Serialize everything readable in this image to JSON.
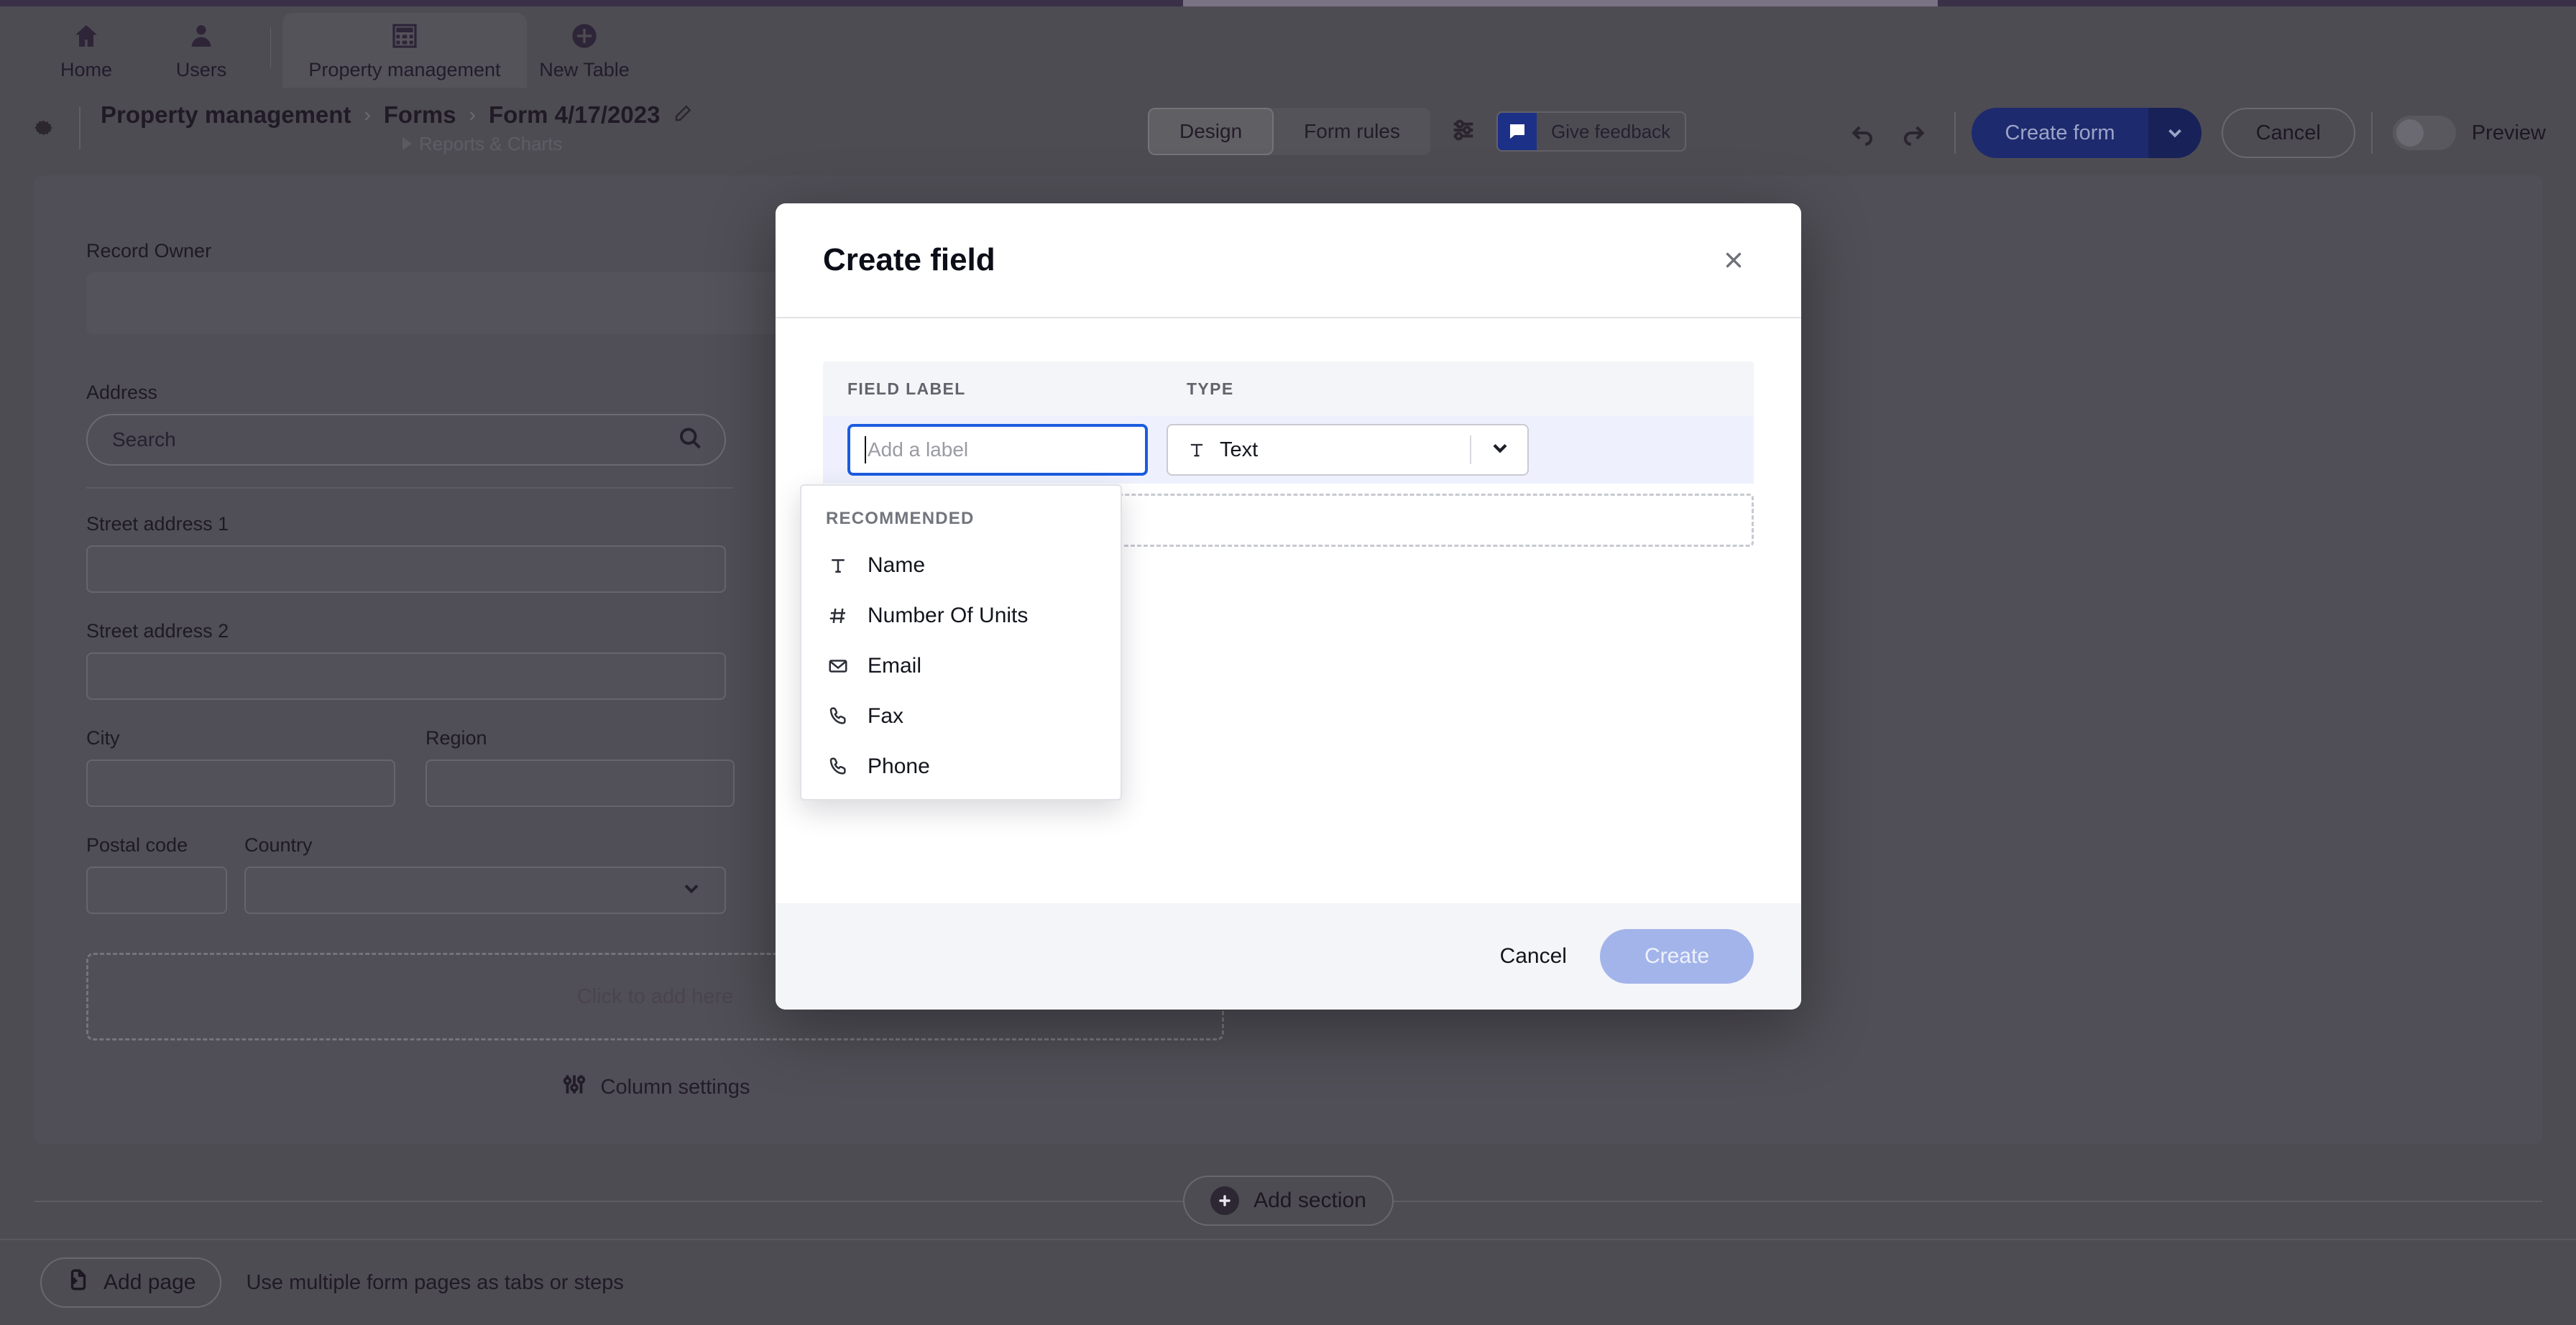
{
  "nav": {
    "items": [
      {
        "label": "Home",
        "icon": "home-icon"
      },
      {
        "label": "Users",
        "icon": "users-icon"
      },
      {
        "label": "Property management",
        "icon": "table-icon",
        "active": true
      },
      {
        "label": "New Table",
        "icon": "plus-circle-icon"
      }
    ]
  },
  "breadcrumb": {
    "gear_icon": "gear-icon",
    "items": [
      "Property management",
      "Forms",
      "Form 4/17/2023"
    ],
    "separator": "›",
    "edit_icon": "pencil-icon",
    "sub_label": "Reports & Charts"
  },
  "toolbar": {
    "tabs": [
      {
        "label": "Design",
        "active": true
      },
      {
        "label": "Form rules",
        "active": false
      }
    ],
    "settings_icon": "sliders-icon",
    "feedback_label": "Give feedback",
    "feedback_icon": "feedback-bubble-icon",
    "feedback_color": "#1c3087",
    "undo_icon": "undo-icon",
    "redo_icon": "redo-icon",
    "create_form_label": "Create form",
    "create_form_color": "#1e2a6e",
    "cancel_label": "Cancel",
    "preview_label": "Preview",
    "preview_on": false
  },
  "form": {
    "fields": [
      {
        "label": "Record Owner",
        "type": "blank"
      },
      {
        "label": "Address",
        "type": "search",
        "placeholder": "Search",
        "icon": "search-icon"
      },
      {
        "label": "Street address 1",
        "type": "text"
      },
      {
        "label": "Street address 2",
        "type": "text"
      },
      {
        "label": "City",
        "type": "text"
      },
      {
        "label": "Region",
        "type": "text"
      },
      {
        "label": "Postal code",
        "type": "text"
      },
      {
        "label": "Country",
        "type": "select",
        "icon": "chevron-down-icon"
      }
    ],
    "dropzone_label": "Click to add here",
    "column_settings_label": "Column settings",
    "column_settings_icon": "sliders-icon",
    "add_section_label": "Add section",
    "add_section_icon": "plus-circle-filled-icon"
  },
  "bottom": {
    "add_page_label": "Add page",
    "add_page_icon": "file-plus-icon",
    "hint": "Use multiple form pages as tabs or steps"
  },
  "modal": {
    "title": "Create field",
    "close_icon": "close-icon",
    "columns": {
      "label": "FIELD LABEL",
      "type": "TYPE"
    },
    "label_input": {
      "value": "",
      "placeholder": "Add a label"
    },
    "type_select": {
      "value": "Text",
      "icon": "text-type-icon",
      "caret_icon": "chevron-down-icon"
    },
    "recommended": {
      "heading": "RECOMMENDED",
      "items": [
        {
          "label": "Name",
          "icon": "text-type-icon"
        },
        {
          "label": "Number Of Units",
          "icon": "hash-icon"
        },
        {
          "label": "Email",
          "icon": "envelope-icon"
        },
        {
          "label": "Fax",
          "icon": "phone-icon"
        },
        {
          "label": "Phone",
          "icon": "phone-icon"
        }
      ]
    },
    "footer": {
      "cancel_label": "Cancel",
      "create_label": "Create",
      "create_disabled": true,
      "create_color": "#a3b4ea"
    }
  }
}
